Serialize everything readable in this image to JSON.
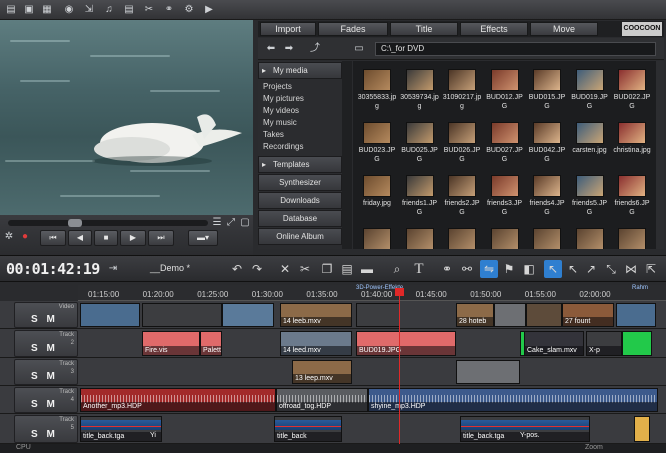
{
  "tabs": [
    "Import",
    "Fades",
    "Title",
    "Effects",
    "Move"
  ],
  "brand": "COOCOON",
  "path": "C:\\_for DVD",
  "sidebar": {
    "my_media": "My media",
    "items": [
      "Projects",
      "My pictures",
      "My videos",
      "My music",
      "Takes",
      "Recordings"
    ],
    "sections": [
      "Templates",
      "Synthesizer",
      "Downloads",
      "Database",
      "Online Album"
    ]
  },
  "thumbnails": [
    "30355833.jpg",
    "30539734.jpg",
    "31090217.jpg",
    "BUD012.JPG",
    "BUD015.JPG",
    "BUD019.JPG",
    "BUD022.JPG",
    "BUD023.JPG",
    "BUD025.JPG",
    "BUD026.JPG",
    "BUD027.JPG",
    "BUD042.JPG",
    "carsten.jpg",
    "christina.jpg",
    "friday.jpg",
    "friends1.JPG",
    "friends2.JPG",
    "friends3.JPG",
    "friends4.JPG",
    "friends5.JPG",
    "friends6.JPG"
  ],
  "timecode": "00:01:42:19",
  "project_name": "__Demo *",
  "ruler": [
    "01:15:00",
    "01:20:00",
    "01:25:00",
    "01:30:00",
    "01:35:00",
    "01:40:00",
    "01:45:00",
    "01:50:00",
    "01:55:00",
    "02:00:00"
  ],
  "ruler_marker": "3D-Power-Effekte",
  "ruler_right": "Rahm",
  "tracks": [
    {
      "label": "Video",
      "num": "1",
      "sm": "S M"
    },
    {
      "label": "Track",
      "num": "2",
      "sm": "S M"
    },
    {
      "label": "Track",
      "num": "3",
      "sm": "S M"
    },
    {
      "label": "Track",
      "num": "4",
      "sm": "S M"
    },
    {
      "label": "Track",
      "num": "5",
      "sm": "S M"
    }
  ],
  "clips": {
    "t1a": "14 leeb.mxv",
    "t1b": "28 hoteb",
    "t1c": "27 fount",
    "t2a": "Fire.vis",
    "t2b": "Palett",
    "t2c": "14 leed.mxv",
    "t2d": "BUD019.JPG",
    "t2e": "Cake_slam.mxv",
    "t2f": "X-p",
    "t3a": "13 leep.mxv",
    "t4a": "Another_mp3.HDP",
    "t4b": "offroad_tog.HDP",
    "t4c": "shyine_mp3.HDP",
    "t5a": "title_back.tga",
    "t5a2": "Yi",
    "t5b": "title_back",
    "t5c": "title_back.tga",
    "t5d": "Y-pos."
  },
  "status_left": "CPU",
  "status_right": "Zoom"
}
